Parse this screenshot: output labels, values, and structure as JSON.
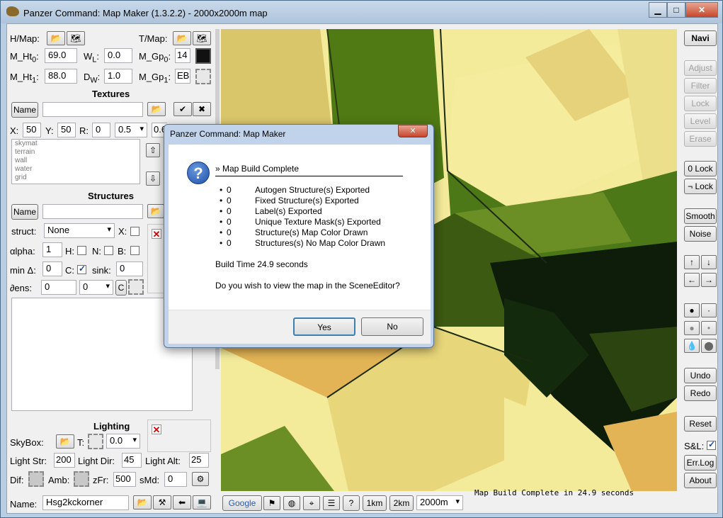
{
  "window": {
    "title": "Panzer Command: Map Maker (1.3.2.2) - 2000x2000m map",
    "controls": {
      "minimize": "▁",
      "maximize": "□",
      "close": "✕"
    }
  },
  "left": {
    "hmap_label": "H/Map:",
    "tmap_label": "T/Map:",
    "m_ht0_label": "M_Ht",
    "m_ht0_sub": "0",
    "m_ht0_suffix": ":",
    "m_ht0_value": "69.0",
    "wl_label": "W",
    "wl_sub": "L",
    "wl_suffix": ":",
    "wl_value": "0.0",
    "m_gp0_label": "M_Gp",
    "m_gp0_sub": "0",
    "m_gp0_suffix": ":",
    "m_gp0_value": "14",
    "m_ht1_label": "M_Ht",
    "m_ht1_sub": "1",
    "m_ht1_suffix": ":",
    "m_ht1_value": "88.0",
    "dw_label": "D",
    "dw_sub": "W",
    "dw_suffix": ":",
    "dw_value": "1.0",
    "m_gp1_label": "M_Gp",
    "m_gp1_sub": "1",
    "m_gp1_suffix": ":",
    "m_gp1_value": "EB",
    "textures": {
      "heading": "Textures",
      "name_button": "Name",
      "name_value": "",
      "x_label": "X:",
      "x_value": "50",
      "y_label": "Y:",
      "y_value": "50",
      "r_label": "R:",
      "r_value": "0",
      "scale_value": "0.5",
      "extra_value": "0.6",
      "list": [
        "skymat",
        "terrain",
        "wall",
        "water",
        "grid"
      ]
    },
    "structures": {
      "heading": "Structures",
      "name_button": "Name",
      "struct_label": "struct:",
      "struct_value": "None",
      "x_label": "X:",
      "alpha_label": "αlpha:",
      "alpha_value": "1",
      "h_label": "H:",
      "n_label": "N:",
      "b_label": "B:",
      "min_label": "min Δ:",
      "min_value": "0",
      "c_label": "C:",
      "sink_label": "sink:",
      "sink_value": "0",
      "dens_label": "∂ens:",
      "dens_value": "0",
      "dens_select": "0",
      "c_button": "C"
    },
    "lighting": {
      "heading": "Lighting",
      "skybox_label": "SkyBox:",
      "t_label": "T:",
      "t_value": "0.0",
      "light_str_label": "Light Str:",
      "light_str_value": "200",
      "light_dir_label": "Light Dir:",
      "light_dir_value": "45",
      "light_alt_label": "Light Alt:",
      "light_alt_value": "25",
      "dif_label": "Dif:",
      "amb_label": "Amb:",
      "zfr_label": "zFr:",
      "zfr_value": "500",
      "smd_label": "sMd:",
      "smd_value": "0"
    },
    "name_label": "Name:",
    "name_value": "Hsg2kckorner"
  },
  "right": {
    "navi": "Navi",
    "adjust": "Adjust",
    "filter": "Filter",
    "lock": "Lock",
    "level": "Level",
    "erase": "Erase",
    "zero_lock": "0 Lock",
    "not_lock": "¬ Lock",
    "smooth": "Smooth",
    "noise": "Noise",
    "undo": "Undo",
    "redo": "Redo",
    "reset": "Reset",
    "sl_label": "S&L:",
    "errlog": "Err.Log",
    "about": "About"
  },
  "bottom": {
    "google": "Google",
    "help": "?",
    "km1": "1km",
    "km2": "2km",
    "zoom": "2000m",
    "status": "Map Build Complete in 24.9 seconds"
  },
  "dialog": {
    "title": "Panzer Command: Map Maker",
    "close": "✕",
    "heading": "» Map Build Complete",
    "items": [
      {
        "count": "0",
        "label": "Autogen Structure(s) Exported"
      },
      {
        "count": "0",
        "label": "Fixed Structure(s) Exported"
      },
      {
        "count": "0",
        "label": "Label(s) Exported"
      },
      {
        "count": "0",
        "label": "Unique Texture Mask(s) Exported"
      },
      {
        "count": "0",
        "label": "Structure(s) Map Color Drawn"
      },
      {
        "count": "0",
        "label": "Structures(s) No Map Color Drawn"
      }
    ],
    "build_time": "Build Time 24.9 seconds",
    "question": "Do you wish to view the map in the SceneEditor?",
    "yes": "Yes",
    "no": "No"
  },
  "colors": {
    "titlebar": "#b9cde3",
    "map_dark": "#0e1c0a",
    "map_green": "#4f7a14",
    "map_yellow": "#f3ea9a",
    "map_orange": "#e3b455"
  }
}
